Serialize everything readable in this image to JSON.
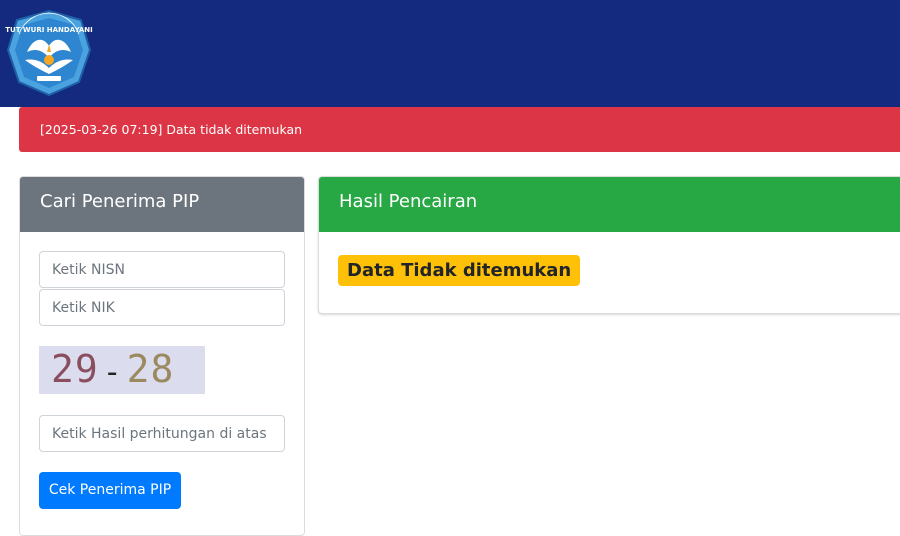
{
  "header": {
    "logo_text": "TUT WURI HANDAYANI",
    "bg_color": "#142a7e"
  },
  "alert": {
    "message": "[2025-03-26 07:19] Data tidak ditemukan",
    "color": "#dc3545"
  },
  "search_card": {
    "title": "Cari Penerima PIP",
    "nisn_placeholder": "Ketik NISN",
    "nik_placeholder": "Ketik NIK",
    "captcha": {
      "first": "29",
      "operator": "-",
      "second": "28"
    },
    "answer_placeholder": "Ketik Hasil perhitungan di atas",
    "submit_label": "Cek Penerima PIP"
  },
  "result_card": {
    "title": "Hasil Pencairan",
    "status_badge": "Data Tidak ditemukan",
    "badge_color": "#ffc107"
  }
}
